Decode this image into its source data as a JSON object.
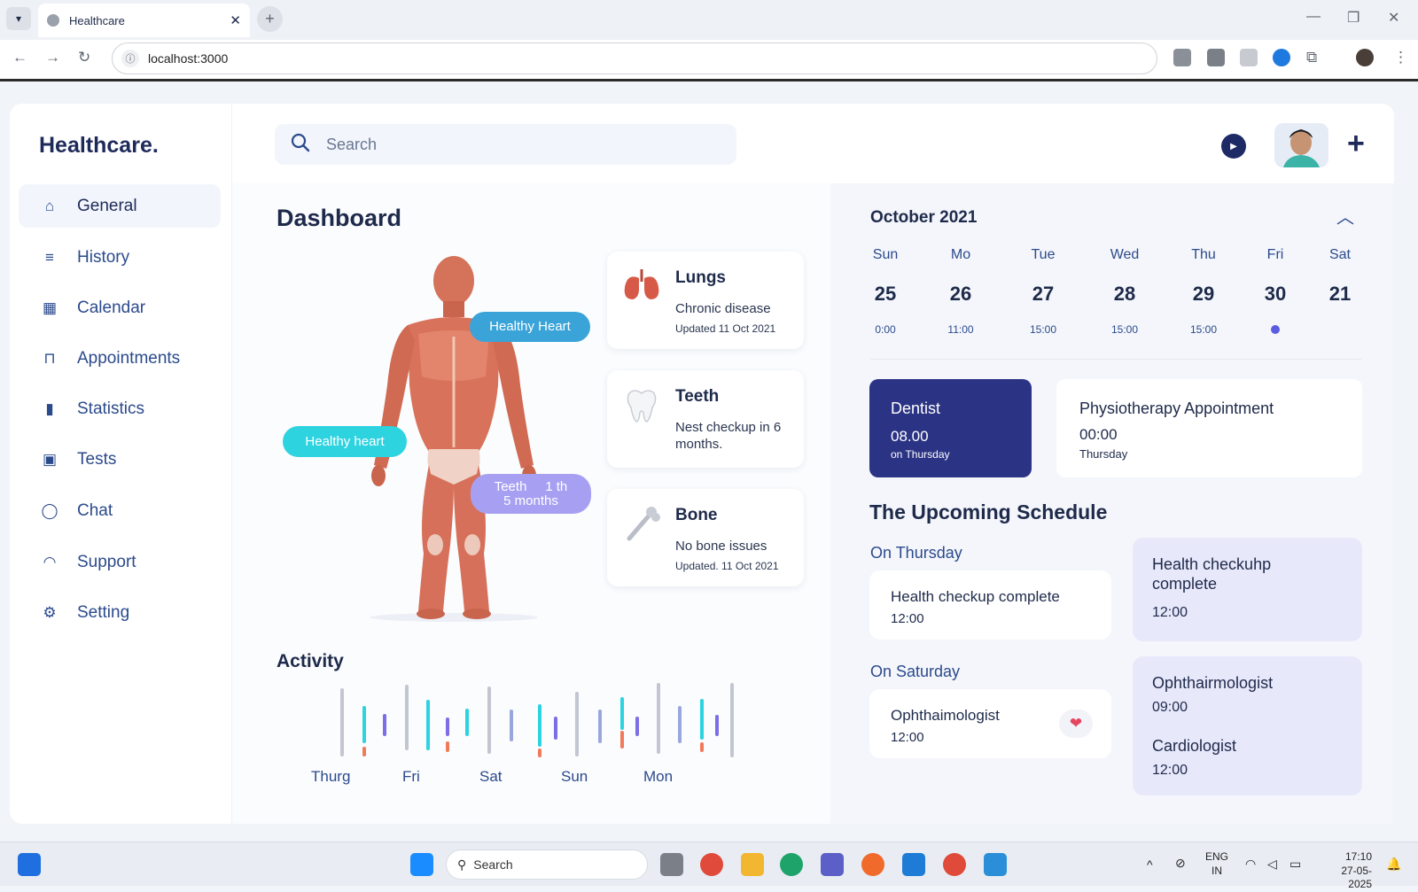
{
  "browser": {
    "tab_title": "Healthcare",
    "url": "localhost:3000"
  },
  "app": {
    "logo": "Healthcare.",
    "search_placeholder": "Search",
    "nav": [
      {
        "label": "General",
        "icon": "home-icon",
        "active": true
      },
      {
        "label": "History",
        "icon": "list-icon"
      },
      {
        "label": "Calendar",
        "icon": "calendar-icon"
      },
      {
        "label": "Appointments",
        "icon": "appointment-icon"
      },
      {
        "label": "Statistics",
        "icon": "bar-chart-icon"
      },
      {
        "label": "Tests",
        "icon": "tests-icon"
      },
      {
        "label": "Chat",
        "icon": "chat-icon"
      },
      {
        "label": "Support",
        "icon": "headset-icon"
      },
      {
        "label": "Setting",
        "icon": "gear-icon"
      }
    ]
  },
  "dashboard": {
    "title": "Dashboard",
    "bubbles": {
      "heart_right": "Healthy Heart",
      "heart_left": "Healthy heart",
      "teeth_line1": "Teeth     1 th",
      "teeth_line2": "5 months"
    },
    "organs": [
      {
        "name": "Lungs",
        "desc": "Chronic disease",
        "updated": "Updated  11 Oct 2021",
        "icon": "lungs-icon"
      },
      {
        "name": "Teeth",
        "desc": "Nest checkup in 6 months.",
        "updated": "",
        "icon": "tooth-icon"
      },
      {
        "name": "Bone",
        "desc": "No bone issues",
        "updated": "Updated. 11 Oct 2021",
        "icon": "bone-icon"
      }
    ],
    "activity": {
      "title": "Activity",
      "day_labels": [
        "Thurg",
        "Fri",
        "Sat",
        "Sun",
        "Mon"
      ]
    }
  },
  "calendar": {
    "month": "October 2021",
    "days": [
      {
        "name": "Sun",
        "num": "25",
        "time": "0:00"
      },
      {
        "name": "Mo",
        "num": "26",
        "time": "11:00"
      },
      {
        "name": "Tue",
        "num": "27",
        "time": "15:00"
      },
      {
        "name": "Wed",
        "num": "28",
        "time": "15:00"
      },
      {
        "name": "Thu",
        "num": "29",
        "time": "15:00"
      },
      {
        "name": "Fri",
        "num": "30",
        "time": ""
      },
      {
        "name": "Sat",
        "num": "21",
        "time": ""
      }
    ]
  },
  "appointments": [
    {
      "title": "Dentist",
      "time": "08.00",
      "day": "on Thursday"
    },
    {
      "title": "Physiotherapy Appointment",
      "time": "00:00",
      "day": "Thursday"
    }
  ],
  "schedule": {
    "title": "The Upcoming Schedule",
    "thursday_label": "On Thursday",
    "saturday_label": "On Saturday",
    "thursday_card": {
      "title": "Health checkup complete",
      "time": "12:00"
    },
    "saturday_card": {
      "title": "Ophthaimologist",
      "time": "12:00"
    },
    "side_card_1": {
      "title": "Health checkuhp complete",
      "time": "12:00"
    },
    "side_card_2": {
      "title1": "Ophthairmologist",
      "time1": "09:00",
      "title2": "Cardiologist",
      "time2": "12:00"
    }
  },
  "taskbar": {
    "search": "Search",
    "lang_line1": "ENG",
    "lang_line2": "IN",
    "time": "17:10",
    "date": "27-05-2025"
  },
  "colors": {
    "primary_dark": "#2b3384",
    "accent_cyan": "#2ed3e0",
    "accent_blue": "#3aa3d8",
    "accent_purple": "#a7a0f2",
    "light_purple": "#e8e8fb"
  }
}
